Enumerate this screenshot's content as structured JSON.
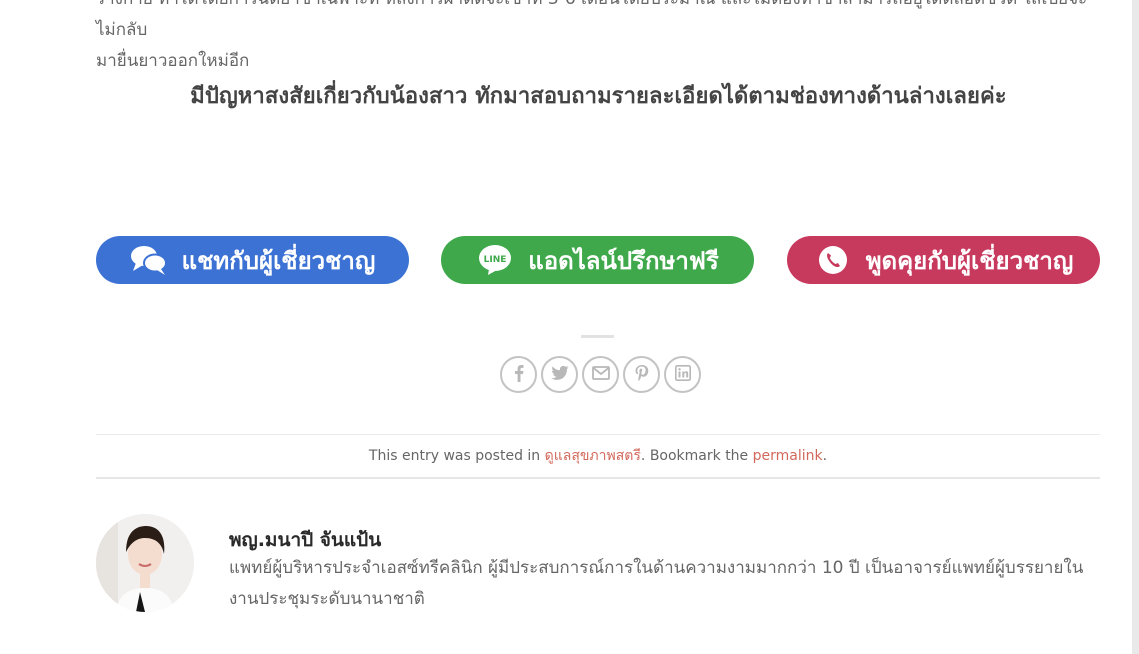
{
  "article": {
    "body_line_1": "ร่างกาย ทำได้โดยการฉีดยาชาเฉพาะที่ หลังการผ่าตัดจะเข้าที่ 3-6 เดือนโดยประมาณ และไม่ต้องทำซ้ำสามารถอยู่ได้ตลอดชีวิต ไส้เปียจะไม่กลับ",
    "body_line_2": "มายื่นยาวออกใหม่อีก",
    "question": "มีปัญหาสงสัยเกี่ยวกับน้องสาว ทักมาสอบถามรายละเอียดได้ตามช่องทางด้านล่างเลยค่ะ"
  },
  "cta": {
    "chat_label": "แชทกับผู้เชี่ยวชาญ",
    "line_label": "แอดไลน์ปรึกษาฟรี",
    "line_logo_text": "LINE",
    "call_label": "พูดคุยกับผู้เชี่ยวชาญ",
    "colors": {
      "chat": "#3b72d4",
      "line": "#3ea84a",
      "call": "#c8395e"
    }
  },
  "share": {
    "icons": [
      "facebook-icon",
      "twitter-icon",
      "email-icon",
      "pinterest-icon",
      "linkedin-icon"
    ]
  },
  "entry_meta": {
    "prefix": "This entry was posted in ",
    "category": "ดูแลสุขภาพสตรี",
    "middle": ". Bookmark the ",
    "permalink": "permalink",
    "suffix": "."
  },
  "author": {
    "name": "พญ.มนาปี จันแป้น",
    "bio": "แพทย์ผู้บริหารประจำเอสซ์ทรีคลินิก ผู้มีประสบการณ์การในด้านความงามมากกว่า 10 ปี เป็นอาจารย์แพทย์ผู้บรรยายในงานประชุมระดับนานาชาติ"
  }
}
